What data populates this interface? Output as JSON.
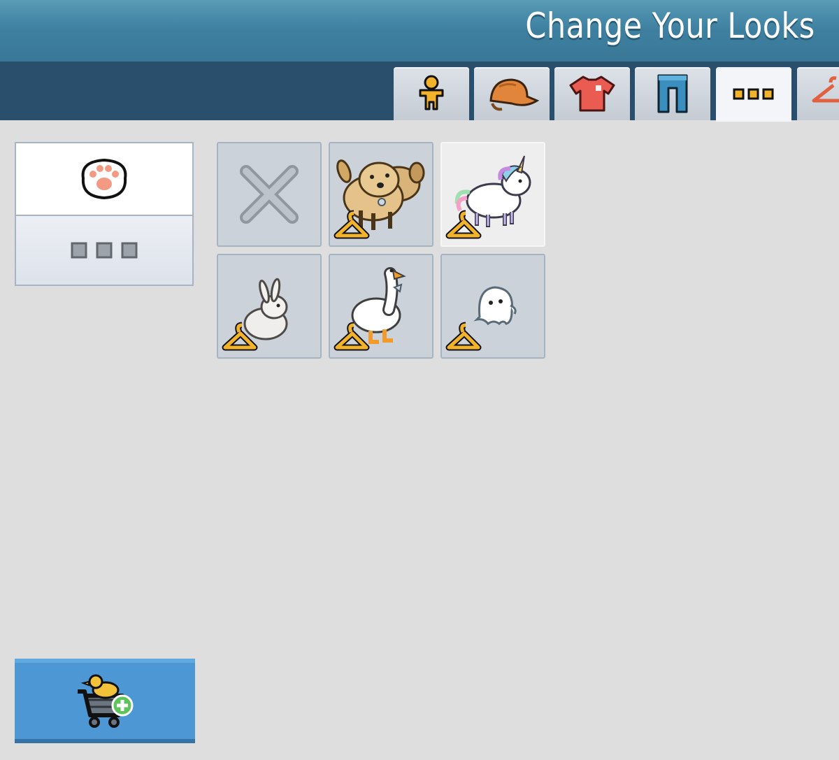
{
  "window": {
    "title": "Change Your Looks"
  },
  "tabs": [
    {
      "icon": "figure-icon",
      "active": false
    },
    {
      "icon": "cap-icon",
      "active": false
    },
    {
      "icon": "shirt-icon",
      "active": false
    },
    {
      "icon": "pants-icon",
      "active": false
    },
    {
      "icon": "more-icon",
      "active": true
    },
    {
      "icon": "hanger-icon",
      "active": false
    }
  ],
  "categories": [
    {
      "icon": "paw-icon",
      "selected": false
    },
    {
      "icon": "more-icon",
      "selected": true
    }
  ],
  "items": [
    {
      "icon": "remove-x-icon",
      "wardrobe_badge": false,
      "selected": false
    },
    {
      "icon": "puppies-pet-icon",
      "wardrobe_badge": true,
      "selected": false
    },
    {
      "icon": "unicorn-pet-icon",
      "wardrobe_badge": true,
      "selected": true
    },
    {
      "icon": "bunny-pet-icon",
      "wardrobe_badge": true,
      "selected": false
    },
    {
      "icon": "goose-pet-icon",
      "wardrobe_badge": true,
      "selected": false
    },
    {
      "icon": "ghost-pet-icon",
      "wardrobe_badge": true,
      "selected": false
    }
  ],
  "cart_button": {
    "icon": "duck-cart-add-icon"
  },
  "colors": {
    "header": "#3e7f9f",
    "tab_bar": "#294f6d",
    "background": "#dededf",
    "cart_button": "#4d97d4",
    "item_tile": "#ccd2d9",
    "badge": "#f2b22a"
  }
}
